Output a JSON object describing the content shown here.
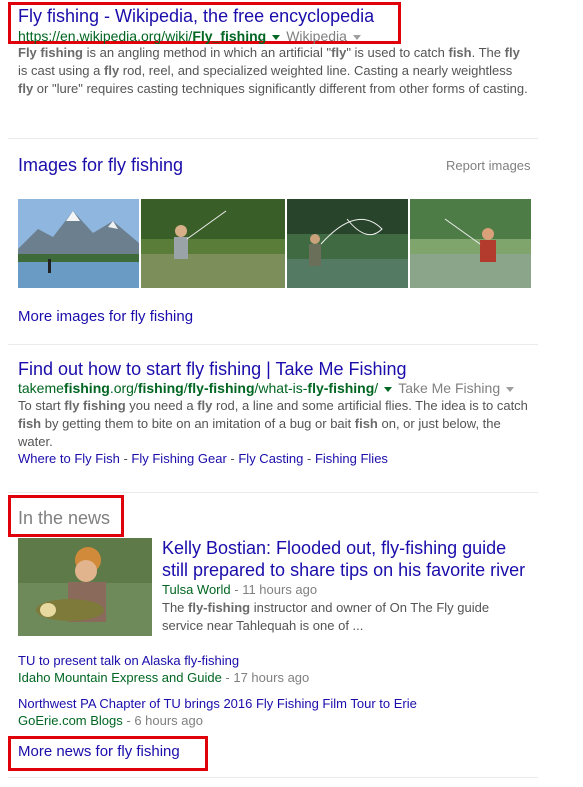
{
  "result1": {
    "title": "Fly fishing - Wikipedia, the free encyclopedia",
    "url_prefix": "https://en.wikipedia.org/wiki/",
    "url_bold": "Fly_fishing",
    "source": "Wikipedia",
    "snippet_parts": [
      "Fly fishing",
      " is an angling method in which an artificial \"",
      "fly",
      "\" is used to catch ",
      "fish",
      ". The ",
      "fly",
      " is cast using a ",
      "fly",
      " rod, reel, and specialized weighted line. Casting a nearly weightless ",
      "fly",
      " or \"lure\" requires casting techniques significantly different from other forms of casting."
    ]
  },
  "images": {
    "heading": "Images for fly fishing",
    "report": "Report images",
    "more": "More images for fly fishing",
    "thumbs": [
      {
        "alt": "mountain lake with angler",
        "sky": "#8fb6df",
        "land": "#3f6b3a",
        "water": "#6a9bc4"
      },
      {
        "alt": "angler wading in stream",
        "sky": "#5a7d3a",
        "land": "#2f4d22",
        "water": "#7c8f5a"
      },
      {
        "alt": "angler casting line",
        "sky": "#3f6a42",
        "land": "#28442a",
        "water": "#547a63"
      },
      {
        "alt": "angler with rod in river",
        "sky": "#7fa56d",
        "land": "#4e7c46",
        "water": "#8aa58a"
      }
    ]
  },
  "result2": {
    "title": "Find out how to start fly fishing | Take Me Fishing",
    "url_parts": [
      "takeme",
      "fishing",
      ".org/",
      "fishing",
      "/",
      "fly-fishing",
      "/what-is-",
      "fly-fishing",
      "/"
    ],
    "source": "Take Me Fishing",
    "snippet_parts": [
      "To start ",
      "fly fishing",
      " you need a ",
      "fly",
      " rod, a line and some artificial flies. The idea is to catch ",
      "fish",
      " by getting them to bite on an imitation of a bug or bait ",
      "fish",
      " on, or just below, the water."
    ],
    "sitelinks": [
      "Where to Fly Fish",
      "Fly Fishing Gear",
      "Fly Casting",
      "Fishing Flies"
    ],
    "sitelink_sep": " - "
  },
  "news": {
    "heading": "In the news",
    "top": {
      "title": "Kelly Bostian: Flooded out, fly-fishing guide still prepared to share tips on his favorite river",
      "source": "Tulsa World",
      "time": " - 11 hours ago",
      "snippet_parts": [
        "The ",
        "fly-fishing",
        " instructor and owner of On The Fly guide service near Tahlequah is one of ..."
      ]
    },
    "items": [
      {
        "title": "TU to present talk on Alaska fly-fishing",
        "source": "Idaho Mountain Express and Guide",
        "time": " - 17 hours ago"
      },
      {
        "title": "Northwest PA Chapter of TU brings 2016 Fly Fishing Film Tour to Erie",
        "source": "GoErie.com Blogs",
        "time": " - 6 hours ago"
      }
    ],
    "more": "More news for fly fishing"
  },
  "colors": {
    "link": "#1a0dab",
    "url": "#006621",
    "highlight_box": "#e0000a"
  }
}
